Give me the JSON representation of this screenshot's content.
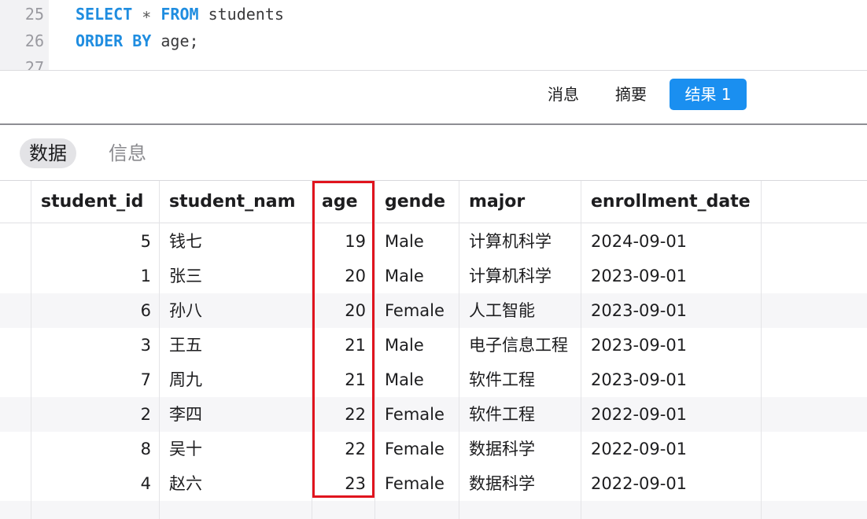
{
  "editor": {
    "lines": [
      {
        "number": "25",
        "tokens": [
          {
            "text": "SELECT",
            "kind": "kw"
          },
          {
            "text": " ",
            "kind": "plain"
          },
          {
            "text": "∗",
            "kind": "op"
          },
          {
            "text": " ",
            "kind": "plain"
          },
          {
            "text": "FROM",
            "kind": "kw"
          },
          {
            "text": " students",
            "kind": "plain"
          }
        ]
      },
      {
        "number": "26",
        "tokens": [
          {
            "text": "ORDER BY",
            "kind": "kw"
          },
          {
            "text": " age;",
            "kind": "plain"
          }
        ]
      },
      {
        "number": "27",
        "tokens": []
      }
    ]
  },
  "result_tabs": [
    {
      "label": "消息",
      "active": false
    },
    {
      "label": "摘要",
      "active": false
    },
    {
      "label": "结果 1",
      "active": true
    }
  ],
  "sub_tabs": [
    {
      "label": "数据",
      "active": true
    },
    {
      "label": "信息",
      "active": false
    }
  ],
  "table": {
    "columns": [
      "student_id",
      "student_nam",
      "age",
      "gende",
      "major",
      "enrollment_date"
    ],
    "rows": [
      [
        "5",
        "钱七",
        "19",
        "Male",
        "计算机科学",
        "2024-09-01"
      ],
      [
        "1",
        "张三",
        "20",
        "Male",
        "计算机科学",
        "2023-09-01"
      ],
      [
        "6",
        "孙八",
        "20",
        "Female",
        "人工智能",
        "2023-09-01"
      ],
      [
        "3",
        "王五",
        "21",
        "Male",
        "电子信息工程",
        "2023-09-01"
      ],
      [
        "7",
        "周九",
        "21",
        "Male",
        "软件工程",
        "2023-09-01"
      ],
      [
        "2",
        "李四",
        "22",
        "Female",
        "软件工程",
        "2022-09-01"
      ],
      [
        "8",
        "吴十",
        "22",
        "Female",
        "数据科学",
        "2022-09-01"
      ],
      [
        "4",
        "赵六",
        "23",
        "Female",
        "数据科学",
        "2022-09-01"
      ]
    ],
    "highlighted_column": "age"
  },
  "colors": {
    "keyword": "#1f8de0",
    "active_tab": "#1a8ff0",
    "highlight_box": "#e0141e"
  }
}
